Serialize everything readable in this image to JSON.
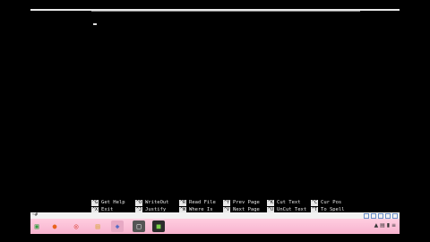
{
  "terminal": {
    "shortcuts": [
      {
        "key": "^G",
        "label": "Get Help"
      },
      {
        "key": "^O",
        "label": "WriteOut"
      },
      {
        "key": "^R",
        "label": "Read File"
      },
      {
        "key": "^Y",
        "label": "Prev Page"
      },
      {
        "key": "^K",
        "label": "Cut Text"
      },
      {
        "key": "^C",
        "label": "Cur Pos"
      },
      {
        "key": "^X",
        "label": "Exit"
      },
      {
        "key": "^J",
        "label": "Justify"
      },
      {
        "key": "^W",
        "label": "Where Is"
      },
      {
        "key": "^V",
        "label": "Next Page"
      },
      {
        "key": "^U",
        "label": "UnCut Text"
      },
      {
        "key": "^T",
        "label": "To Spell"
      }
    ]
  },
  "commandbar": {
    "text": "~# "
  },
  "taskbar": {
    "apps": [
      {
        "icon": "start-icon",
        "glyph": "▣"
      },
      {
        "icon": "firefox-icon",
        "glyph": "●"
      },
      {
        "icon": "chrome-icon",
        "glyph": "◎"
      },
      {
        "icon": "folder-icon",
        "glyph": "▤"
      },
      {
        "icon": "virtualbox-icon",
        "glyph": "◈"
      },
      {
        "icon": "document-icon",
        "glyph": "□"
      },
      {
        "icon": "terminal-icon",
        "glyph": "■"
      }
    ],
    "tray": {
      "text": "▲  ▤  ▮  ≡"
    }
  }
}
